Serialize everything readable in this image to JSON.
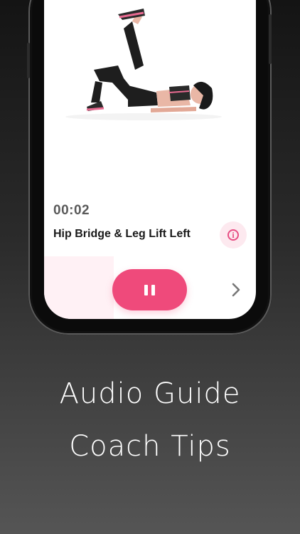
{
  "workout": {
    "timer": "00:02",
    "exercise_name": "Hip Bridge & Leg Lift Left",
    "illustration_icon": "woman-leg-lift-illustration",
    "info_icon": "info-icon",
    "pause_icon": "pause-icon",
    "next_icon": "chevron-right-icon",
    "progress_fraction": 0.33
  },
  "caption": {
    "line1": "Audio Guide",
    "line2": "Coach Tips"
  },
  "colors": {
    "accent": "#ef4a7b",
    "accent_light": "#fde9ef",
    "progress_bg": "#fff1f5"
  }
}
